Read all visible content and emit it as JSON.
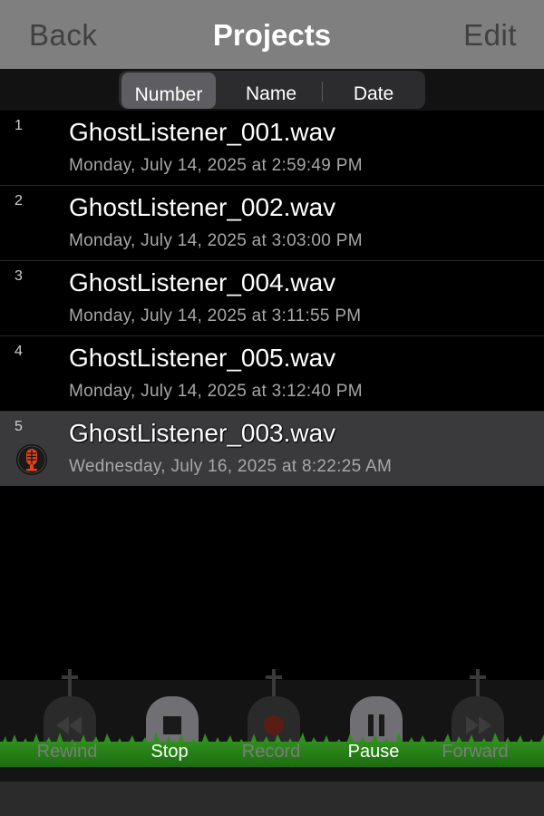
{
  "navbar": {
    "back_label": "Back",
    "title": "Projects",
    "edit_label": "Edit"
  },
  "sort": {
    "options": [
      "Number",
      "Name",
      "Date"
    ],
    "selected": "Number"
  },
  "projects": [
    {
      "number": "1",
      "name": "GhostListener_001.wav",
      "date": "Monday, July 14, 2025 at 2:59:49 PM",
      "active": false
    },
    {
      "number": "2",
      "name": "GhostListener_002.wav",
      "date": "Monday, July 14, 2025 at 3:03:00 PM",
      "active": false
    },
    {
      "number": "3",
      "name": "GhostListener_004.wav",
      "date": "Monday, July 14, 2025 at 3:11:55 PM",
      "active": false
    },
    {
      "number": "4",
      "name": "GhostListener_005.wav",
      "date": "Monday, July 14, 2025 at 3:12:40 PM",
      "active": false
    },
    {
      "number": "5",
      "name": "GhostListener_003.wav",
      "date": "Wednesday, July 16, 2025 at 8:22:25 AM",
      "active": true,
      "icon": "microphone-icon"
    }
  ],
  "toolbar": {
    "rewind_label": "Rewind",
    "stop_label": "Stop",
    "record_label": "Record",
    "pause_label": "Pause",
    "forward_label": "Forward"
  },
  "colors": {
    "navbar": "#7f7f7f",
    "grass": "#2f8f1d",
    "record_icon": "#e8401a"
  }
}
